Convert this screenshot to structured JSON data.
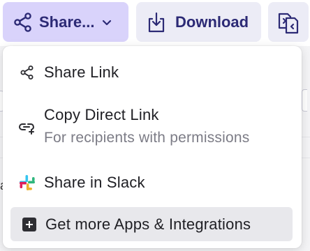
{
  "toolbar": {
    "share_label": "Share...",
    "download_label": "Download",
    "icons": {
      "share": "share-nodes-icon",
      "chevron": "chevron-down-icon",
      "download": "download-tray-icon",
      "compare": "document-compare-icon"
    }
  },
  "menu": {
    "items": [
      {
        "label": "Share Link",
        "icon": "share-nodes-icon"
      },
      {
        "label": "Copy Direct Link",
        "sublabel": "For recipients with permissions",
        "icon": "link-plus-icon"
      },
      {
        "label": "Share in Slack",
        "icon": "slack-logo-icon"
      },
      {
        "label": "Get more Apps & Integrations",
        "icon": "plus-square-icon"
      }
    ]
  },
  "background": {
    "partial_letter": "a"
  },
  "colors": {
    "primary_text": "#2c2a75",
    "share_button_bg": "#d9d3fb",
    "secondary_button_bg": "#ececf6",
    "highlight_bg": "#e8e8ec",
    "slack_blue": "#36c5f0",
    "slack_green": "#2eb67d",
    "slack_yellow": "#ecb22e",
    "slack_red": "#e01e5a"
  }
}
